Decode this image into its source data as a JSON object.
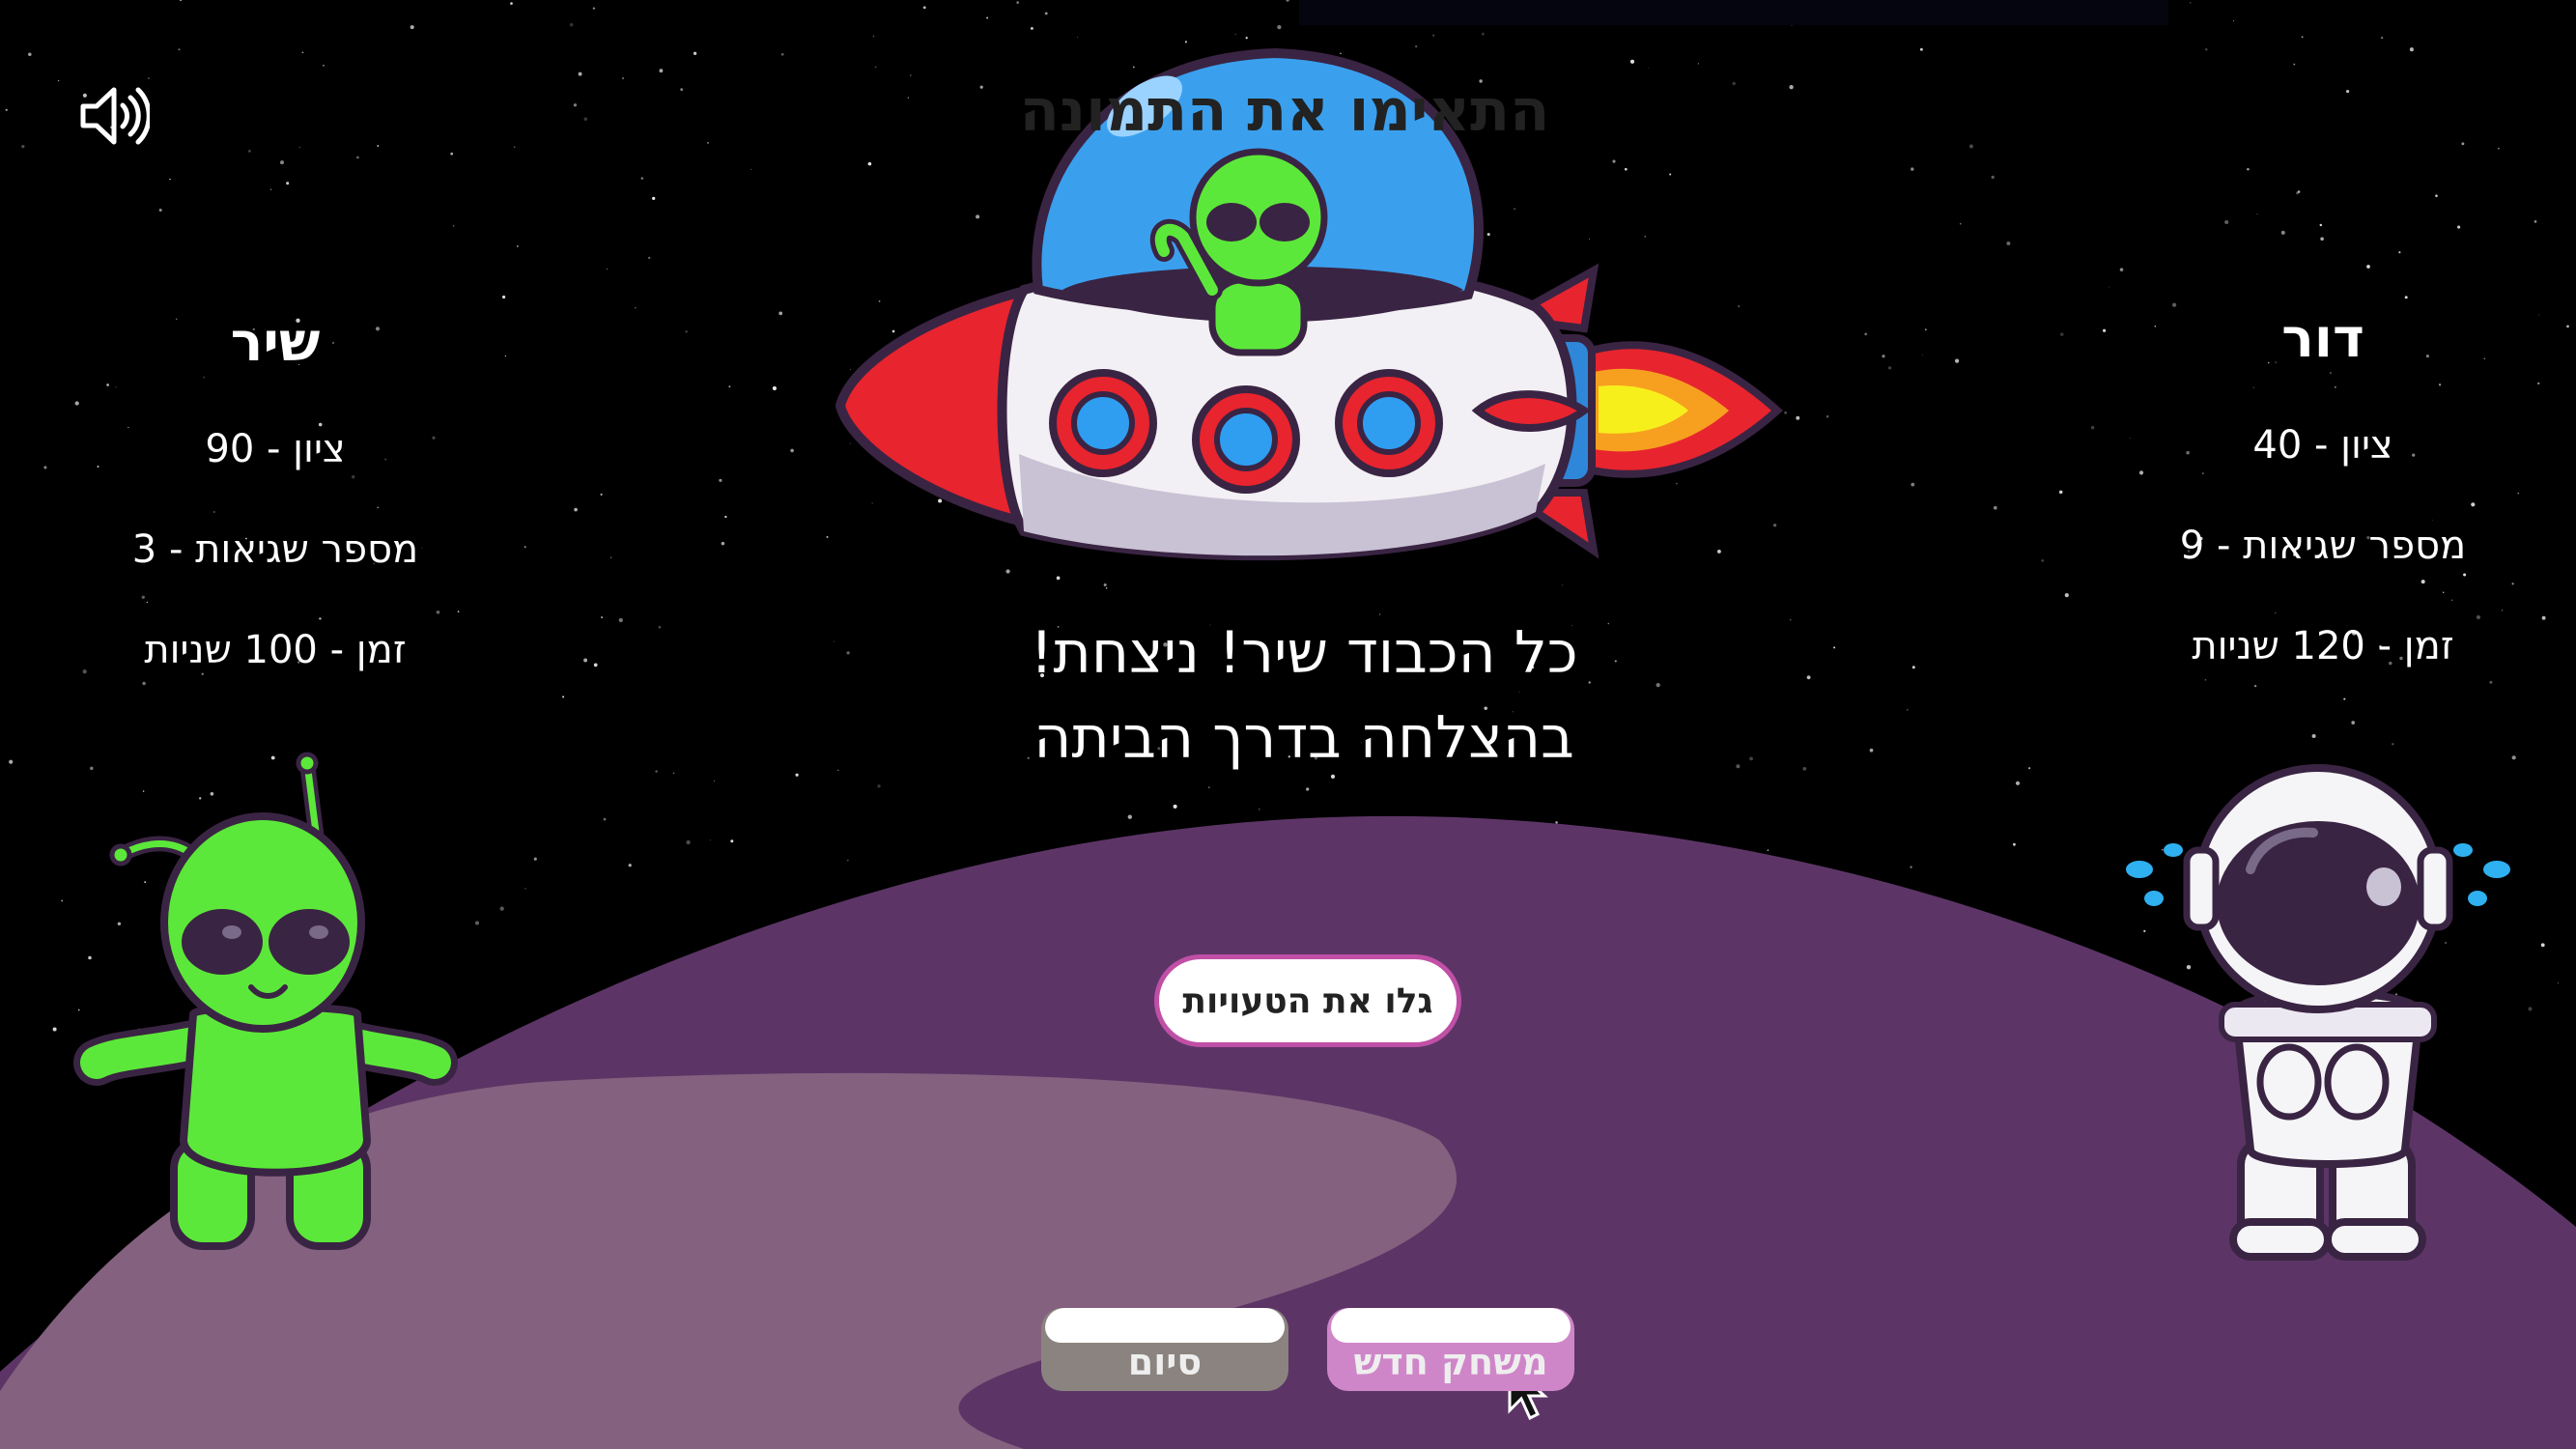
{
  "title": "התאימו את התמונה",
  "sound": {
    "icon": "speaker-icon"
  },
  "players": {
    "left": {
      "name": "שיר",
      "grade": "ציון - 90",
      "mistakes": "מספר שגיאות - 3",
      "time": "זמן - 100 שניות"
    },
    "right": {
      "name": "דור",
      "grade": "ציון - 40",
      "mistakes": "מספר שגיאות - 9",
      "time": "זמן - 120 שניות"
    }
  },
  "message": {
    "line1": "כל הכבוד שיר! ניצחת!",
    "line2": "בהצלחה בדרך הביתה"
  },
  "buttons": {
    "reveal": "גלו את הטעויות",
    "end": "סיום",
    "new_game": "משחק חדש"
  },
  "colors": {
    "planet": "#5c3566",
    "planet_light": "#84617f",
    "accent": "#c04fa6",
    "alien_green": "#5ce83a"
  }
}
